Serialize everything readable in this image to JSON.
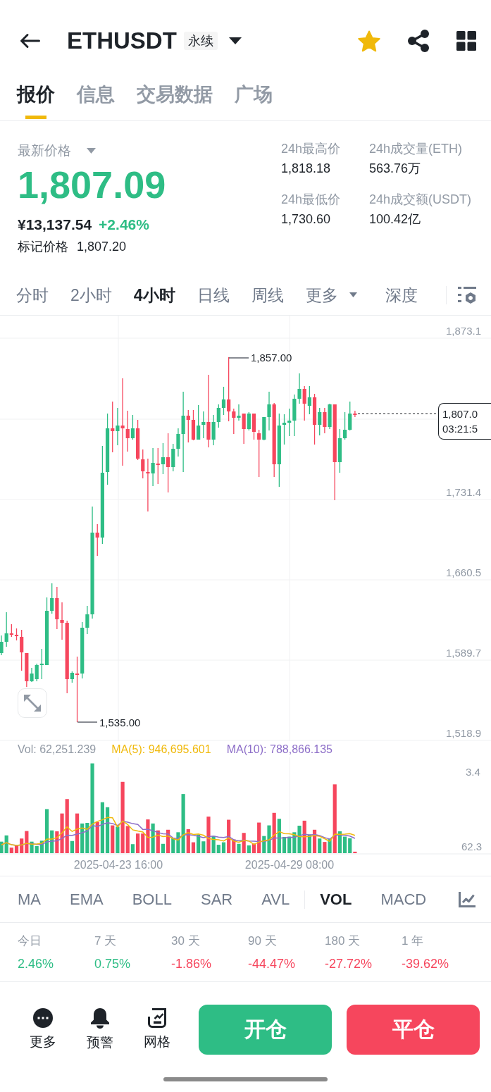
{
  "header": {
    "symbol": "ETHUSDT",
    "badge": "永续",
    "favorited": true
  },
  "tabs": [
    {
      "label": "报价",
      "selected": true
    },
    {
      "label": "信息",
      "selected": false
    },
    {
      "label": "交易数据",
      "selected": false
    },
    {
      "label": "广场",
      "selected": false
    }
  ],
  "price_panel": {
    "price_label": "最新价格",
    "last_price": "1,807.09",
    "cny_price": "¥13,137.54",
    "change": "+2.46%",
    "mark_label": "标记价格",
    "mark_price": "1,807.20",
    "stats": [
      {
        "label": "24h最高价",
        "value": "1,818.18"
      },
      {
        "label": "24h成交量(ETH)",
        "value": "563.76万"
      },
      {
        "label": "24h最低价",
        "value": "1,730.60"
      },
      {
        "label": "24h成交额(USDT)",
        "value": "100.42亿"
      }
    ]
  },
  "intervals": [
    {
      "label": "分时",
      "selected": false,
      "dropdown": false
    },
    {
      "label": "2小时",
      "selected": false,
      "dropdown": false
    },
    {
      "label": "4小时",
      "selected": true,
      "dropdown": false
    },
    {
      "label": "日线",
      "selected": false,
      "dropdown": false
    },
    {
      "label": "周线",
      "selected": false,
      "dropdown": false
    },
    {
      "label": "更多",
      "selected": false,
      "dropdown": true
    },
    {
      "label": "深度",
      "selected": false,
      "dropdown": false
    }
  ],
  "chart": {
    "y_axis_labels": [
      "1,873.1",
      "1,731.4",
      "1,660.5",
      "1,589.7",
      "1,518.9"
    ],
    "high_label": "1,857.00",
    "low_label": "1,535.00",
    "price_tag": {
      "price": "1,807.0",
      "time": "03:21:5"
    }
  },
  "volume": {
    "vol_label": "Vol: 62,251.239",
    "ma5_label": "MA(5): 946,695.601",
    "ma10_label": "MA(10): 788,866.135",
    "axis_labels": [
      "3.4",
      "62.3"
    ],
    "dates": [
      "2025-04-23 16:00",
      "2025-04-29 08:00"
    ]
  },
  "main_indicators": [
    {
      "label": "MA",
      "selected": false
    },
    {
      "label": "EMA",
      "selected": false
    },
    {
      "label": "BOLL",
      "selected": false
    },
    {
      "label": "SAR",
      "selected": false
    },
    {
      "label": "AVL",
      "selected": false
    }
  ],
  "sub_indicators": [
    {
      "label": "VOL",
      "selected": true
    },
    {
      "label": "MACD",
      "selected": false
    }
  ],
  "performance": [
    {
      "period": "今日",
      "change": "2.46%",
      "color": "#2ebd85"
    },
    {
      "period": "7 天",
      "change": "0.75%",
      "color": "#2ebd85"
    },
    {
      "period": "30 天",
      "change": "-1.86%",
      "color": "#f6465d"
    },
    {
      "period": "90 天",
      "change": "-44.47%",
      "color": "#f6465d"
    },
    {
      "period": "180 天",
      "change": "-27.72%",
      "color": "#f6465d"
    },
    {
      "period": "1 年",
      "change": "-39.62%",
      "color": "#f6465d"
    }
  ],
  "bottom_bar": {
    "actions": [
      {
        "label": "更多",
        "kind": "more"
      },
      {
        "label": "预警",
        "kind": "alert"
      },
      {
        "label": "网格",
        "kind": "grid"
      }
    ],
    "buttons": [
      {
        "label": "开仓",
        "kind": "open"
      },
      {
        "label": "平仓",
        "kind": "close"
      }
    ]
  }
}
